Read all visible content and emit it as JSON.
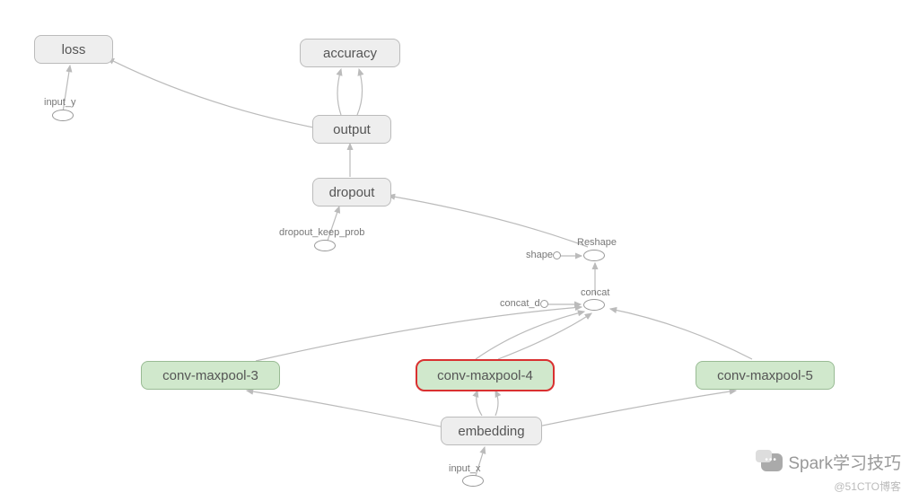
{
  "nodes": {
    "loss": "loss",
    "accuracy": "accuracy",
    "output": "output",
    "dropout": "dropout",
    "conv3": "conv-maxpool-3",
    "conv4": "conv-maxpool-4",
    "conv5": "conv-maxpool-5",
    "embedding": "embedding"
  },
  "labels": {
    "input_y": "input_y",
    "dropout_keep_prob": "dropout_keep_prob",
    "reshape": "Reshape",
    "shape": "shape",
    "concat": "concat",
    "concat_d": "concat_d...",
    "input_x": "input_x"
  },
  "watermarks": {
    "main": "Spark学习技巧",
    "sub": "@51CTO博客"
  }
}
